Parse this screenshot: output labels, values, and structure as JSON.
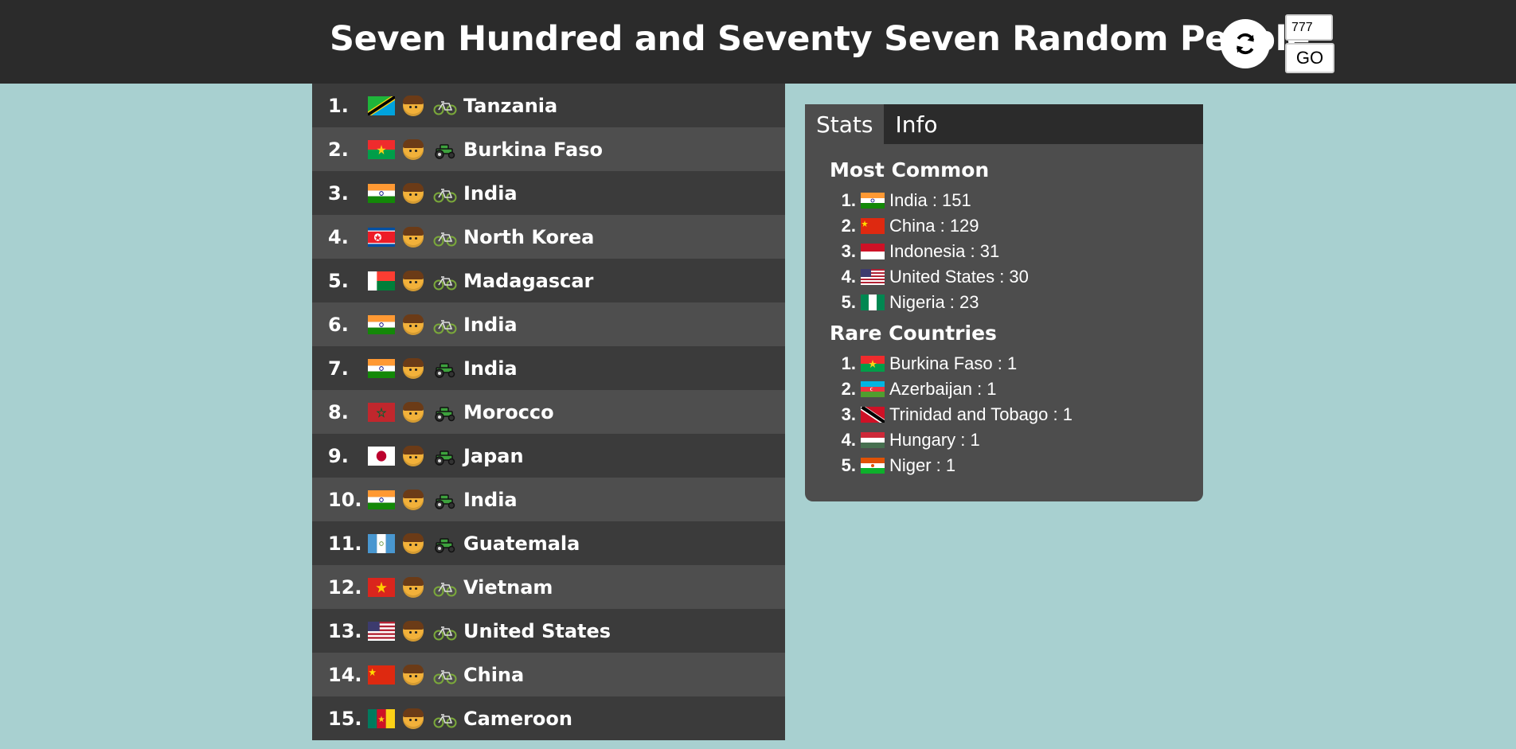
{
  "header": {
    "title": "Seven Hundred and Seventy Seven Random People",
    "refresh_icon": "refresh-icon",
    "count_value": "777",
    "go_label": "GO"
  },
  "people": [
    {
      "num": "1.",
      "country": "Tanzania",
      "flag": "tanzania",
      "vehicle": "bicycle"
    },
    {
      "num": "2.",
      "country": "Burkina Faso",
      "flag": "burkina",
      "vehicle": "tractor"
    },
    {
      "num": "3.",
      "country": "India",
      "flag": "india",
      "vehicle": "bicycle"
    },
    {
      "num": "4.",
      "country": "North Korea",
      "flag": "nkorea",
      "vehicle": "bicycle"
    },
    {
      "num": "5.",
      "country": "Madagascar",
      "flag": "madagascar",
      "vehicle": "bicycle"
    },
    {
      "num": "6.",
      "country": "India",
      "flag": "india",
      "vehicle": "bicycle"
    },
    {
      "num": "7.",
      "country": "India",
      "flag": "india",
      "vehicle": "tractor"
    },
    {
      "num": "8.",
      "country": "Morocco",
      "flag": "morocco",
      "vehicle": "tractor"
    },
    {
      "num": "9.",
      "country": "Japan",
      "flag": "japan",
      "vehicle": "tractor"
    },
    {
      "num": "10.",
      "country": "India",
      "flag": "india",
      "vehicle": "tractor"
    },
    {
      "num": "11.",
      "country": "Guatemala",
      "flag": "guatemala",
      "vehicle": "tractor"
    },
    {
      "num": "12.",
      "country": "Vietnam",
      "flag": "vietnam",
      "vehicle": "bicycle"
    },
    {
      "num": "13.",
      "country": "United States",
      "flag": "usa",
      "vehicle": "bicycle"
    },
    {
      "num": "14.",
      "country": "China",
      "flag": "china",
      "vehicle": "bicycle"
    },
    {
      "num": "15.",
      "country": "Cameroon",
      "flag": "cameroon",
      "vehicle": "bicycle"
    }
  ],
  "stats": {
    "tabs": [
      "Stats",
      "Info"
    ],
    "most_common_title": "Most Common",
    "most_common": [
      {
        "num": "1.",
        "text": "India : 151",
        "flag": "india"
      },
      {
        "num": "2.",
        "text": "China : 129",
        "flag": "china"
      },
      {
        "num": "3.",
        "text": "Indonesia : 31",
        "flag": "indonesia"
      },
      {
        "num": "4.",
        "text": "United States : 30",
        "flag": "usa"
      },
      {
        "num": "5.",
        "text": "Nigeria : 23",
        "flag": "nigeria"
      }
    ],
    "rare_title": "Rare Countries",
    "rare": [
      {
        "num": "1.",
        "text": "Burkina Faso : 1",
        "flag": "burkina"
      },
      {
        "num": "2.",
        "text": "Azerbaijan : 1",
        "flag": "azerbaijan"
      },
      {
        "num": "3.",
        "text": "Trinidad and Tobago : 1",
        "flag": "trinidad"
      },
      {
        "num": "4.",
        "text": "Hungary : 1",
        "flag": "hungary"
      },
      {
        "num": "5.",
        "text": "Niger : 1",
        "flag": "niger"
      }
    ]
  }
}
